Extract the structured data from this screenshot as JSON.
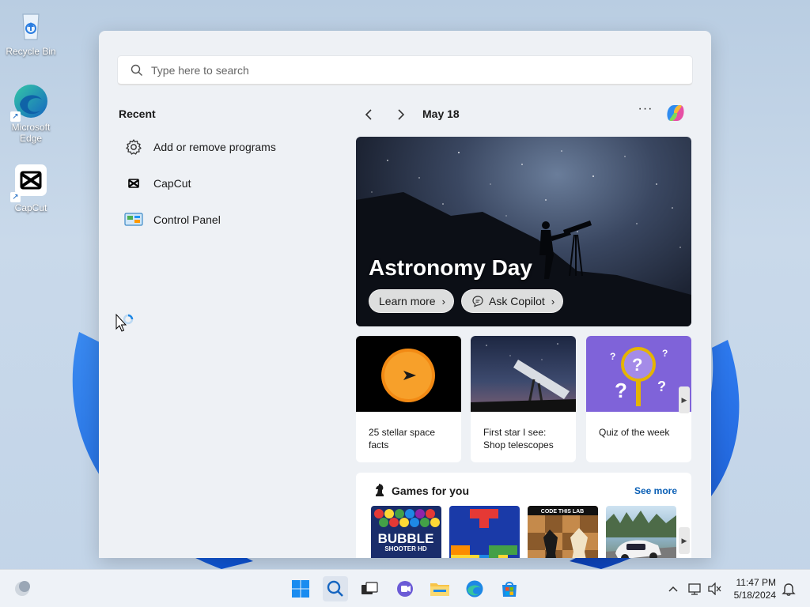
{
  "desktop": {
    "icons": [
      {
        "label": "Recycle Bin"
      },
      {
        "label": "Microsoft Edge"
      },
      {
        "label": "CapCut"
      }
    ]
  },
  "search": {
    "placeholder": "Type here to search"
  },
  "recent": {
    "title": "Recent",
    "items": [
      {
        "label": "Add or remove programs",
        "icon": "gear-icon"
      },
      {
        "label": "CapCut",
        "icon": "capcut-icon"
      },
      {
        "label": "Control Panel",
        "icon": "control-panel-icon"
      }
    ]
  },
  "widgets": {
    "date": "May 18",
    "more": "···",
    "hero": {
      "title": "Astronomy Day",
      "learn_more": "Learn more",
      "ask_copilot": "Ask Copilot"
    },
    "cards": [
      {
        "caption": "25 stellar space facts"
      },
      {
        "caption": "First star I see: Shop telescopes"
      },
      {
        "caption": "Quiz of the week"
      }
    ],
    "games": {
      "title": "Games for you",
      "see_more": "See more",
      "tiles": [
        {
          "name": "bubble-shooter",
          "text_line1": "BUBBLE",
          "text_line2": "SHOOTER HD"
        },
        {
          "name": "block-puzzle"
        },
        {
          "name": "chess",
          "banner": "CODE THIS LAB"
        },
        {
          "name": "racing"
        }
      ]
    }
  },
  "taskbar": {
    "time": "11:47 PM",
    "date": "5/18/2024"
  },
  "colors": {
    "accent": "#0a5fb5",
    "panel_bg": "#eef1f5",
    "taskbar_bg": "#eef2f7"
  }
}
